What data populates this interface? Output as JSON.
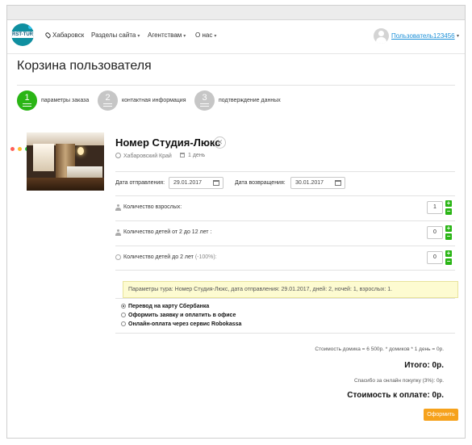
{
  "nav": {
    "logo_text": "RST-TUR",
    "city": "Хабаровск",
    "menu": [
      "Разделы сайта",
      "Агентствам",
      "О нас"
    ],
    "user": "Пользователь123456"
  },
  "page_title": "Корзина пользователя",
  "steps": [
    {
      "num": "1",
      "label": "параметры заказа",
      "active": true
    },
    {
      "num": "2",
      "label": "контактная информация",
      "active": false
    },
    {
      "num": "3",
      "label": "подтверждение данных",
      "active": false
    }
  ],
  "window_dots": [
    "#ff5f57",
    "#febc2e",
    "#28c840"
  ],
  "room": {
    "title": "Номер Студия-Люкс",
    "region": "Хабаровский Край",
    "duration": "1 день",
    "remove_glyph": "✕"
  },
  "dates": {
    "departure_label": "Дата отправления:",
    "departure_value": "29.01.2017",
    "return_label": "Дата возвращения:",
    "return_value": "30.01.2017"
  },
  "guests": {
    "adults_label": "Количество взрослых:",
    "adults_value": "1",
    "children_label": "Количество детей от 2 до 12 лет :",
    "children_value": "0",
    "infants_label": "Количество детей до 2 лет",
    "infants_note": "(-100%):",
    "infants_value": "0",
    "plus": "+",
    "minus": "−"
  },
  "notice": "Параметры тура: Номер Студия-Люкс, дата отправления: 29.01.2017, дней: 2, ночей: 1, взрослых: 1.",
  "payment_options": [
    {
      "label": "Перевод на карту Сбербанка",
      "checked": true
    },
    {
      "label": "Оформить заявку и оплатить в офисе",
      "checked": false
    },
    {
      "label": "Онлайн-оплата через сервис Robokassa",
      "checked": false
    }
  ],
  "summary": {
    "calc": "Стоимость домика = 6 500р. * домиков * 1 день = 0р.",
    "total": "Итого: 0р.",
    "fee": "Спасибо за онлайн покупку (3%): 0р.",
    "to_pay": "Стоимость к оплате: 0р.",
    "checkout": "Оформить"
  },
  "colors": {
    "accent_green": "#2ab515",
    "accent_orange": "#f6a21c",
    "link_blue": "#1a8fd8",
    "notice_bg": "#fdfbd1"
  }
}
